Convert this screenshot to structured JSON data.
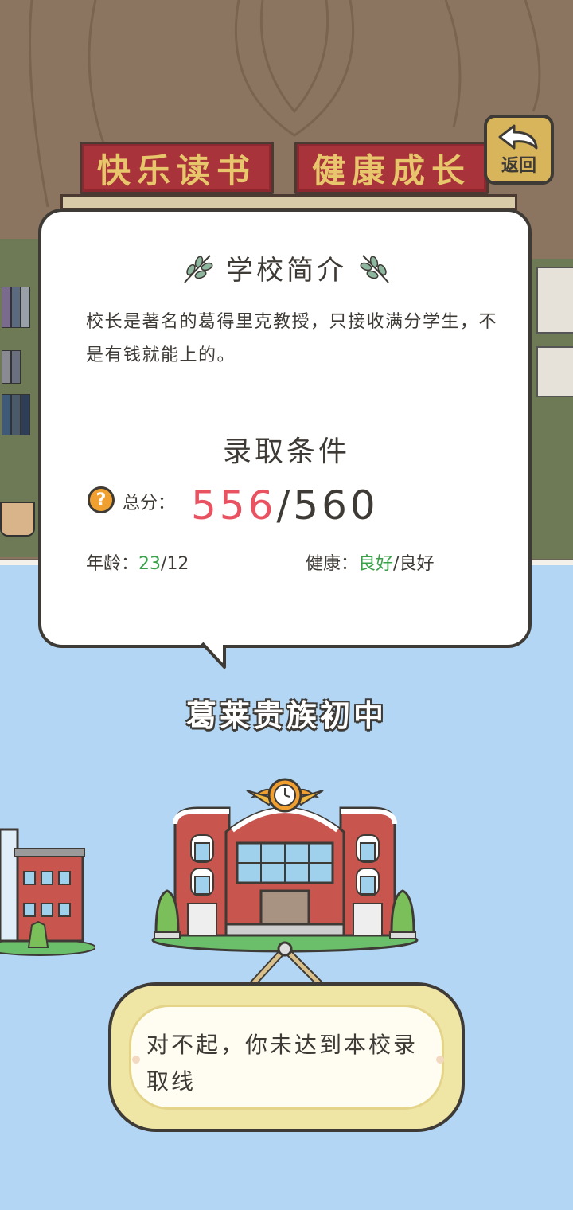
{
  "header": {
    "banner_left": "快乐读书",
    "banner_right": "健康成长",
    "back_button_label": "返回"
  },
  "school_card": {
    "intro_title": "学校简介",
    "intro_text": "校长是著名的葛得里克教授，只接收满分学生，不是有钱就能上的。",
    "conditions_title": "录取条件",
    "score_label": "总分：",
    "score_value": "556",
    "score_separator": "/",
    "score_required": "560",
    "age_label": "年龄：",
    "age_value": "23",
    "age_separator": "/",
    "age_required": "12",
    "health_label": "健康：",
    "health_value": "良好",
    "health_separator": "/",
    "health_required": "良好"
  },
  "school_name": "葛莱贵族初中",
  "message": "对不起，你未达到本校录取线",
  "colors": {
    "score_value": "#e95260",
    "pass_value": "#3aa14a",
    "sky": "#b2d6f4",
    "wall": "#8c7560",
    "banner": "#a8333a",
    "back_button": "#d8b45a"
  },
  "icons": {
    "back": "back-arrow-icon",
    "help": "question-mark-icon",
    "leaf": "leaf-sprig-icon",
    "clock": "clock-icon"
  }
}
